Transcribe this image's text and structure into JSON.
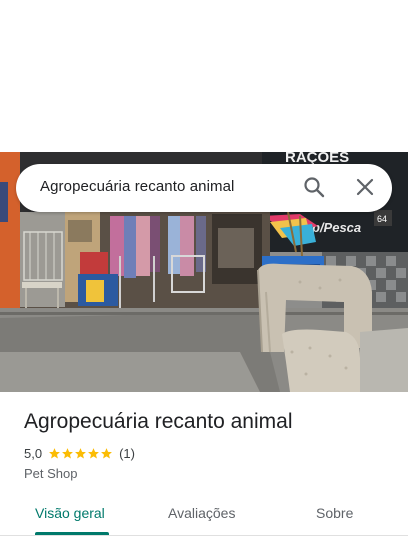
{
  "search": {
    "query": "Agropecuária recanto animal"
  },
  "photo": {
    "sign_text": "RAÇÕES",
    "sign_sub": "p/Pesca",
    "address_number": "64"
  },
  "place": {
    "name": "Agropecuária recanto animal",
    "rating": "5,0",
    "review_count": "(1)",
    "category": "Pet Shop",
    "stars": 5
  },
  "tabs": [
    {
      "label": "Visão geral",
      "active": true
    },
    {
      "label": "Avaliações",
      "active": false
    },
    {
      "label": "Sobre",
      "active": false
    }
  ],
  "colors": {
    "accent": "#00796b",
    "star": "#fbbc04"
  },
  "icons": {
    "search": "search-icon",
    "close": "close-icon",
    "star": "star-icon"
  }
}
